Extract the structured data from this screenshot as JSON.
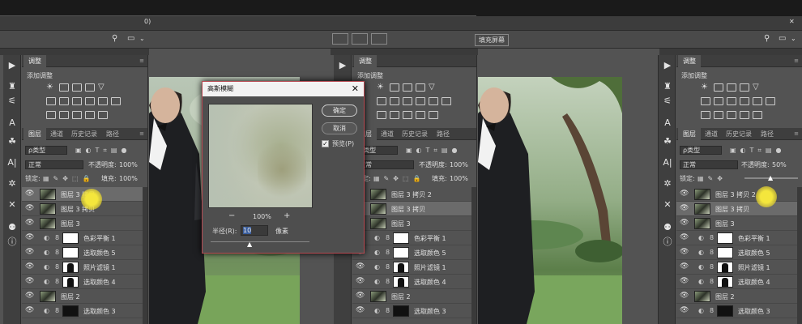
{
  "left": {
    "top_field": "",
    "menu_fragment": "0)",
    "adjust_panel": {
      "tab": "调整",
      "add_label": "添加调整"
    },
    "layers_tabs": [
      "图层",
      "通道",
      "历史记录",
      "路径"
    ],
    "filter_label": "ρ类型",
    "blend_mode": "正常",
    "opacity_label": "不透明度:",
    "opacity_value": "100%",
    "lock_label": "锁定:",
    "fill_label": "填充:",
    "fill_value": "100%",
    "layers": [
      {
        "name": "图层 3 拷贝",
        "thumb": "photo",
        "selected": true
      },
      {
        "name": "图层 3 拷贝",
        "thumb": "photo",
        "selected": false
      },
      {
        "name": "图层 3",
        "thumb": "photo",
        "selected": false
      },
      {
        "name": "色彩平衡 1",
        "thumb": "white",
        "selected": false
      },
      {
        "name": "选取颜色 5",
        "thumb": "white",
        "selected": false
      },
      {
        "name": "照片滤镜 1",
        "thumb": "mask",
        "selected": false
      },
      {
        "name": "选取颜色 4",
        "thumb": "mask",
        "selected": false
      },
      {
        "name": "图层 2",
        "thumb": "photo",
        "selected": false
      },
      {
        "name": "选取颜色 3",
        "thumb": "black",
        "selected": false
      }
    ]
  },
  "dialog": {
    "title": "高斯模糊",
    "ok_label": "确定",
    "cancel_label": "取消",
    "preview_label": "预览(P)",
    "zoom_value": "100%",
    "zoom_out_icon": "−",
    "zoom_in_icon": "+",
    "radius_label": "半径(R):",
    "radius_value": "10",
    "unit_label": "像素"
  },
  "right": {
    "menu_fragment": "填充屏幕",
    "adjust_panel": {
      "tab": "调整",
      "add_label": "添加调整"
    },
    "layers_tabs": [
      "图层",
      "通道",
      "历史记录",
      "路径"
    ],
    "filter_label": "ρ类型",
    "blend_mode": "正常",
    "opacity_label": "不透明度:",
    "opacity_value": "50%",
    "lock_label": "锁定:",
    "layers": [
      {
        "name": "图层 3 拷贝 2",
        "thumb": "photo",
        "selected": false
      },
      {
        "name": "图层 3 拷贝",
        "thumb": "photo",
        "selected": true
      },
      {
        "name": "图层 3",
        "thumb": "photo",
        "selected": false
      },
      {
        "name": "色彩平衡 1",
        "thumb": "white",
        "selected": false
      },
      {
        "name": "选取颜色 5",
        "thumb": "white",
        "selected": false
      },
      {
        "name": "照片滤镜 1",
        "thumb": "mask",
        "selected": false
      },
      {
        "name": "选取颜色 4",
        "thumb": "mask",
        "selected": false
      },
      {
        "name": "图层 2",
        "thumb": "photo",
        "selected": false
      },
      {
        "name": "选取颜色 3",
        "thumb": "black",
        "selected": false
      }
    ],
    "opacity_slider_fraction": 0.5
  },
  "mid_tab_labels": [
    "图层",
    "通道",
    "历史记录",
    "路径"
  ],
  "mid_lock_label": "锁定:",
  "mid_fill_label": "填充:",
  "mid_fill_value": "100%",
  "mid_opacity_label": "不透明度:",
  "mid_opacity_value": "100%",
  "mid_blend_mode": "正常",
  "mid_filter_label": "ρ类型",
  "mid_adjust_tab": "调整",
  "mid_adjust_add": "添加调整",
  "mid_layers": [
    "图层 3 拷贝 2",
    "图层 3 拷贝",
    "图层 3",
    "色彩平衡 1",
    "选取颜色 5",
    "照片滤镜 1",
    "选取颜色 4",
    "图层 2",
    "选取颜色 3"
  ],
  "colors": {
    "accent": "#b64a52",
    "cursor": "#f4e63c",
    "panel": "#535353"
  }
}
